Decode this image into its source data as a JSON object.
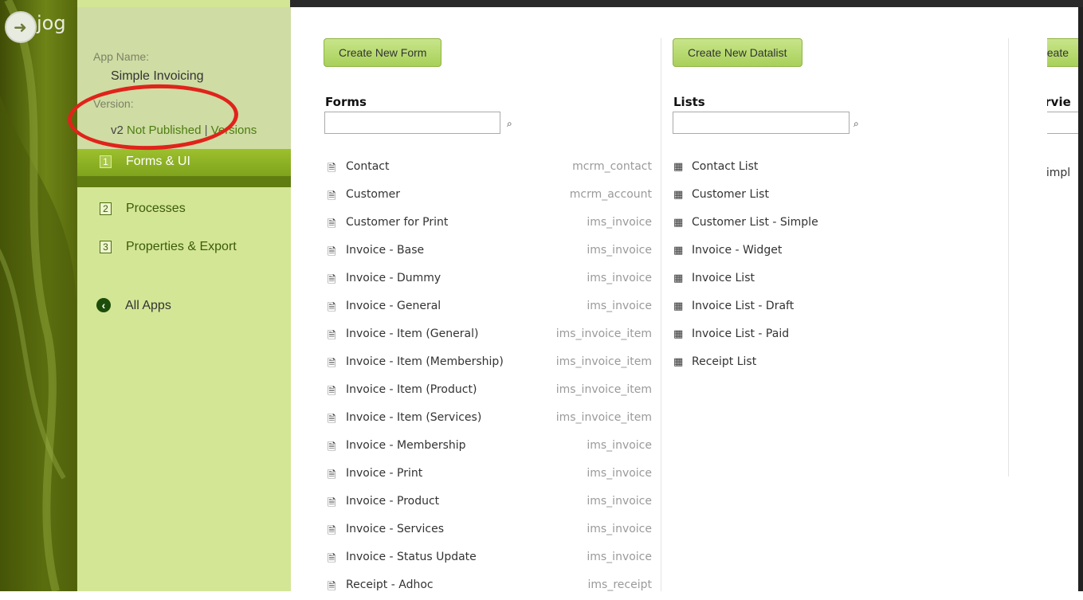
{
  "brand": {
    "text": "jog"
  },
  "app_info": {
    "name_label": "App Name:",
    "name": "Simple Invoicing",
    "version_label": "Version:",
    "version": "v2",
    "status": "Not Published",
    "separator": "|",
    "versions_link": "Versions"
  },
  "nav": {
    "items": [
      {
        "num": "1",
        "label": "Forms & UI"
      },
      {
        "num": "2",
        "label": "Processes"
      },
      {
        "num": "3",
        "label": "Properties & Export"
      }
    ],
    "all_apps": "All Apps"
  },
  "forms": {
    "create_button": "Create New Form",
    "title": "Forms",
    "items": [
      {
        "name": "Contact",
        "table": "mcrm_contact"
      },
      {
        "name": "Customer",
        "table": "mcrm_account"
      },
      {
        "name": "Customer for Print",
        "table": "ims_invoice"
      },
      {
        "name": "Invoice - Base",
        "table": "ims_invoice"
      },
      {
        "name": "Invoice - Dummy",
        "table": "ims_invoice"
      },
      {
        "name": "Invoice - General",
        "table": "ims_invoice"
      },
      {
        "name": "Invoice - Item (General)",
        "table": "ims_invoice_item"
      },
      {
        "name": "Invoice - Item (Membership)",
        "table": "ims_invoice_item"
      },
      {
        "name": "Invoice - Item (Product)",
        "table": "ims_invoice_item"
      },
      {
        "name": "Invoice - Item (Services)",
        "table": "ims_invoice_item"
      },
      {
        "name": "Invoice - Membership",
        "table": "ims_invoice"
      },
      {
        "name": "Invoice - Print",
        "table": "ims_invoice"
      },
      {
        "name": "Invoice - Product",
        "table": "ims_invoice"
      },
      {
        "name": "Invoice - Services",
        "table": "ims_invoice"
      },
      {
        "name": "Invoice - Status Update",
        "table": "ims_invoice"
      },
      {
        "name": "Receipt - Adhoc",
        "table": "ims_receipt"
      }
    ]
  },
  "lists": {
    "create_button": "Create New Datalist",
    "title": "Lists",
    "items": [
      "Contact List",
      "Customer List",
      "Customer List - Simple",
      "Invoice - Widget",
      "Invoice List",
      "Invoice List - Draft",
      "Invoice List - Paid",
      "Receipt List"
    ]
  },
  "userviews": {
    "create_button": "Create",
    "title": "Uservie",
    "items": [
      "Simpl"
    ]
  },
  "icons": {
    "form": "file-text-icon",
    "list": "calendar-icon",
    "userview": "monitor-icon",
    "search": "search-icon",
    "back": "circle-arrow-left-icon"
  },
  "colors": {
    "sidebar_bg": "#d3e696",
    "nav_active": "#8cb126",
    "button_green": "#b8dc72",
    "highlight_ellipse": "#e0231b"
  }
}
